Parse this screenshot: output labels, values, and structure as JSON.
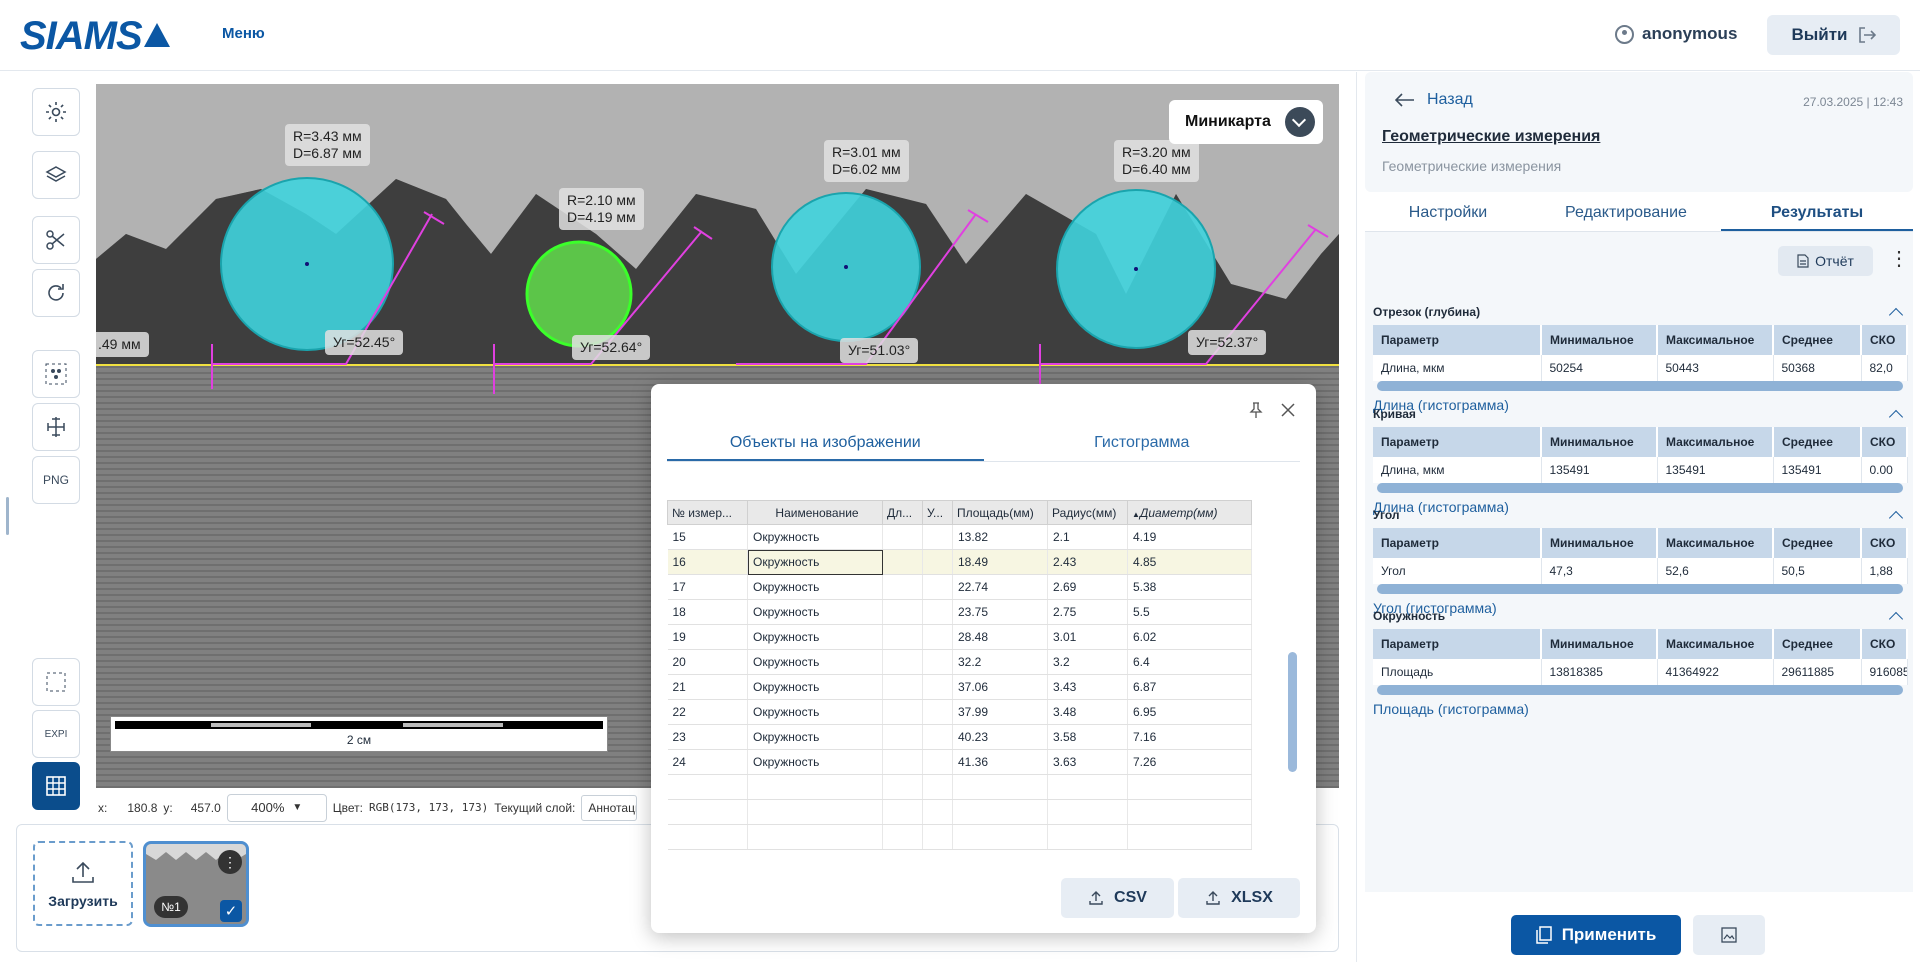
{
  "header": {
    "logo_text": "SIAMS",
    "menu_label": "Меню",
    "user_name": "anonymous",
    "logout_label": "Выйти"
  },
  "toolbar": {
    "png_label": "PNG",
    "exp_label": "EXPI"
  },
  "canvas": {
    "minimap_label": "Миникарта",
    "scale_label": "2 см",
    "labels": [
      {
        "line1": "R=3.43 мм",
        "line2": "D=6.87 мм"
      },
      {
        "line1": "R=2.10 мм",
        "line2": "D=4.19 мм"
      },
      {
        "line1": "R=3.01 мм",
        "line2": "D=6.02 мм"
      },
      {
        "line1": "R=3.20 мм",
        "line2": "D=6.40 мм"
      }
    ],
    "angles": [
      "Уг=52.45°",
      "Уг=52.64°",
      "Уг=51.03°",
      "Уг=52.37°"
    ],
    "left_fragment": ".49 мм"
  },
  "status": {
    "x_label": "x:",
    "x_value": "180.8",
    "y_label": "y:",
    "y_value": "457.0",
    "zoom": "400%",
    "color_label": "Цвет:",
    "color_value": "RGB(173, 173, 173)",
    "layer_label": "Текущий слой:",
    "layer_value": "Аннотация"
  },
  "bottom": {
    "upload_label": "Загрузить",
    "thumb_num": "№1"
  },
  "dialog": {
    "tabs": [
      "Объекты на изображении",
      "Гистограмма"
    ],
    "columns": [
      "№ измер...",
      "Наименование",
      "Дл...",
      "У...",
      "Площадь(мм)",
      "Радиус(мм)",
      "Диаметр(мм)"
    ],
    "rows": [
      [
        "15",
        "Окружность",
        "",
        "",
        "13.82",
        "2.1",
        "4.19"
      ],
      [
        "16",
        "Окружность",
        "",
        "",
        "18.49",
        "2.43",
        "4.85"
      ],
      [
        "17",
        "Окружность",
        "",
        "",
        "22.74",
        "2.69",
        "5.38"
      ],
      [
        "18",
        "Окружность",
        "",
        "",
        "23.75",
        "2.75",
        "5.5"
      ],
      [
        "19",
        "Окружность",
        "",
        "",
        "28.48",
        "3.01",
        "6.02"
      ],
      [
        "20",
        "Окружность",
        "",
        "",
        "32.2",
        "3.2",
        "6.4"
      ],
      [
        "21",
        "Окружность",
        "",
        "",
        "37.06",
        "3.43",
        "6.87"
      ],
      [
        "22",
        "Окружность",
        "",
        "",
        "37.99",
        "3.48",
        "6.95"
      ],
      [
        "23",
        "Окружность",
        "",
        "",
        "40.23",
        "3.58",
        "7.16"
      ],
      [
        "24",
        "Окружность",
        "",
        "",
        "41.36",
        "3.63",
        "7.26"
      ]
    ],
    "csv_label": "CSV",
    "xlsx_label": "XLSX"
  },
  "right": {
    "back_label": "Назад",
    "date": "27.03.2025 | 12:43",
    "title": "Геометрические измерения",
    "subtitle": "Геометрические измерения",
    "tabs": [
      "Настройки",
      "Редактирование",
      "Результаты"
    ],
    "report_label": "Отчёт",
    "result_columns": [
      "Параметр",
      "Минимальное",
      "Максимальное",
      "Среднее",
      "СКО"
    ],
    "sections": [
      {
        "title": "Отрезок (глубина)",
        "row": [
          "Длина, мкм",
          "50254",
          "50443",
          "50368",
          "82,0"
        ],
        "link": "Длина (гистограмма)"
      },
      {
        "title": "Кривая",
        "row": [
          "Длина, мкм",
          "135491",
          "135491",
          "135491",
          "0.00"
        ],
        "link": "Длина (гистограмма)"
      },
      {
        "title": "Угол",
        "row": [
          "Угол",
          "47,3",
          "52,6",
          "50,5",
          "1,88"
        ],
        "link": "Угол (гистограмма)"
      },
      {
        "title": "Окружность",
        "row": [
          "Площадь",
          "13818385",
          "41364922",
          "29611885",
          "916085"
        ],
        "link": "Площадь (гистограмма)"
      }
    ],
    "apply_label": "Применить"
  }
}
